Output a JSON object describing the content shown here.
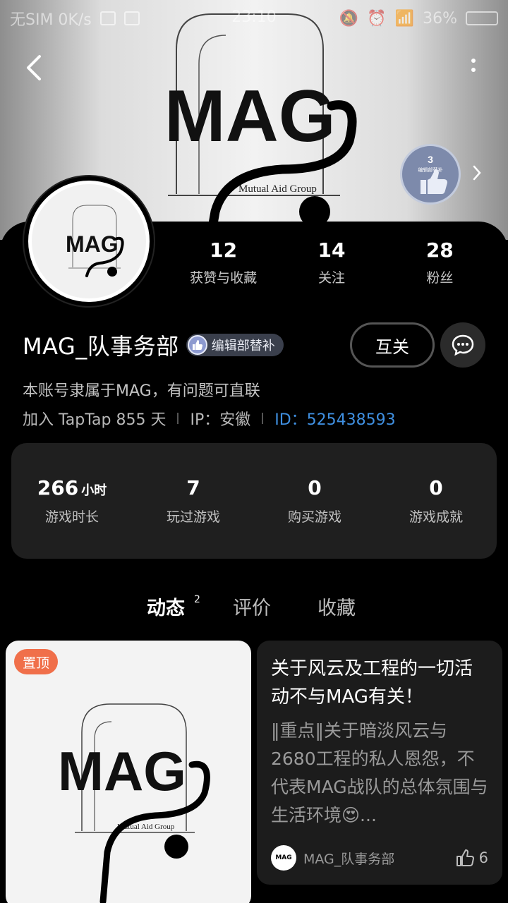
{
  "status_bar": {
    "left": "无SIM 0K/s",
    "time": "23:10",
    "battery": "36%"
  },
  "cover": {
    "logo_text": "MAG",
    "logo_sub": "Mutual Aid Group",
    "badge_number": "3",
    "badge_text": "编辑部替补"
  },
  "profile": {
    "username": "MAG_队事务部",
    "role": "编辑部替补",
    "bio": "本账号隶属于MAG，有问题可直联",
    "join": "加入 TapTap 855 天",
    "ip": "IP：安徽",
    "id": "ID：525438593",
    "mutual_label": "互关",
    "avatar_text": "MAG"
  },
  "stats": [
    {
      "value": "12",
      "label": "获赞与收藏"
    },
    {
      "value": "14",
      "label": "关注"
    },
    {
      "value": "28",
      "label": "粉丝"
    }
  ],
  "game_stats": {
    "playtime": {
      "value": "266",
      "unit": "小时",
      "label": "游戏时长"
    },
    "played": {
      "value": "7",
      "label": "玩过游戏"
    },
    "bought": {
      "value": "0",
      "label": "购买游戏"
    },
    "achievements": {
      "value": "0",
      "label": "游戏成就"
    }
  },
  "tabs": {
    "dynamics": "动态",
    "dynamics_count": "2",
    "reviews": "评价",
    "favorites": "收藏"
  },
  "posts": {
    "pinned_label": "置顶",
    "left_logo": "MAG",
    "left_logo_sub": "Mutual Aid Group",
    "right": {
      "title": "关于风云及工程的一切活动不与MAG有关！",
      "body": "‖重点‖关于暗淡风云与2680工程的私人恩怨，不代表MAG战队的总体氛围与生活环境😍...",
      "author": "MAG_队事务部",
      "author_avatar": "MAG",
      "likes": "6"
    }
  },
  "colors": {
    "accent": "#14b9ad",
    "pin": "#f06f4a",
    "id_link": "#3f8fe0"
  }
}
